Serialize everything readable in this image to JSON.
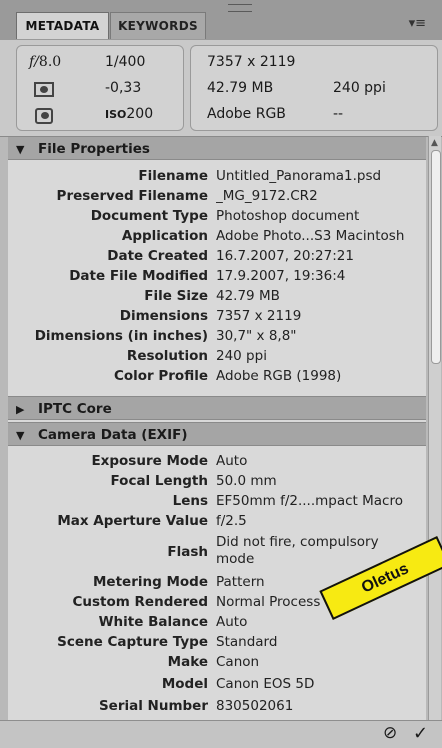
{
  "tabs": {
    "metadata": "METADATA",
    "keywords": "KEYWORDS"
  },
  "header": {
    "aperture_icon": "f/",
    "aperture": "8.0",
    "shutter": "1/400",
    "metering_icon": "metering-icon",
    "exposure_comp": "-0,33",
    "camera_icon": "camera-icon",
    "iso_label": "ISO",
    "iso": "200",
    "dimensions": "7357 x 2119",
    "file_size": "42.79 MB",
    "resolution": "240 ppi",
    "color_space": "Adobe RGB",
    "extra": "--"
  },
  "sections": {
    "file_properties": "File Properties",
    "iptc_core": "IPTC Core",
    "camera_data": "Camera Data (EXIF)"
  },
  "file_properties": [
    {
      "label": "Filename",
      "value": "Untitled_Panorama1.psd"
    },
    {
      "label": "Preserved Filename",
      "value": "_MG_9172.CR2"
    },
    {
      "label": "Document Type",
      "value": "Photoshop document"
    },
    {
      "label": "Application",
      "value": "Adobe Photo...S3 Macintosh"
    },
    {
      "label": "Date Created",
      "value": "16.7.2007, 20:27:21"
    },
    {
      "label": "Date File Modified",
      "value": "17.9.2007, 19:36:4"
    },
    {
      "label": "File Size",
      "value": "42.79 MB"
    },
    {
      "label": "Dimensions",
      "value": "7357 x 2119"
    },
    {
      "label": "Dimensions (in inches)",
      "value": "30,7\" x 8,8\""
    },
    {
      "label": "Resolution",
      "value": "240 ppi"
    },
    {
      "label": "Color Profile",
      "value": "Adobe RGB (1998)"
    }
  ],
  "camera_data": [
    {
      "label": "Exposure Mode",
      "value": "Auto"
    },
    {
      "label": "Focal Length",
      "value": "50.0 mm"
    },
    {
      "label": "Lens",
      "value": "EF50mm f/2....mpact Macro"
    },
    {
      "label": "Max Aperture Value",
      "value": "f/2.5"
    },
    {
      "label": "Flash",
      "value": "Did not fire, compulsory mode"
    },
    {
      "label": "Metering Mode",
      "value": "Pattern"
    },
    {
      "label": "Custom Rendered",
      "value": "Normal Process"
    },
    {
      "label": "White Balance",
      "value": "Auto"
    },
    {
      "label": "Scene Capture Type",
      "value": "Standard"
    },
    {
      "label": "Make",
      "value": "Canon"
    },
    {
      "label": "Model",
      "value": "Canon EOS 5D"
    },
    {
      "label": "Serial Number",
      "value": "830502061"
    }
  ],
  "sticker": {
    "text": "Oletus",
    "color": "#f7ea12"
  },
  "icons": {
    "cancel": "cancel-icon",
    "apply": "checkmark-icon",
    "menu": "panel-menu-icon"
  }
}
